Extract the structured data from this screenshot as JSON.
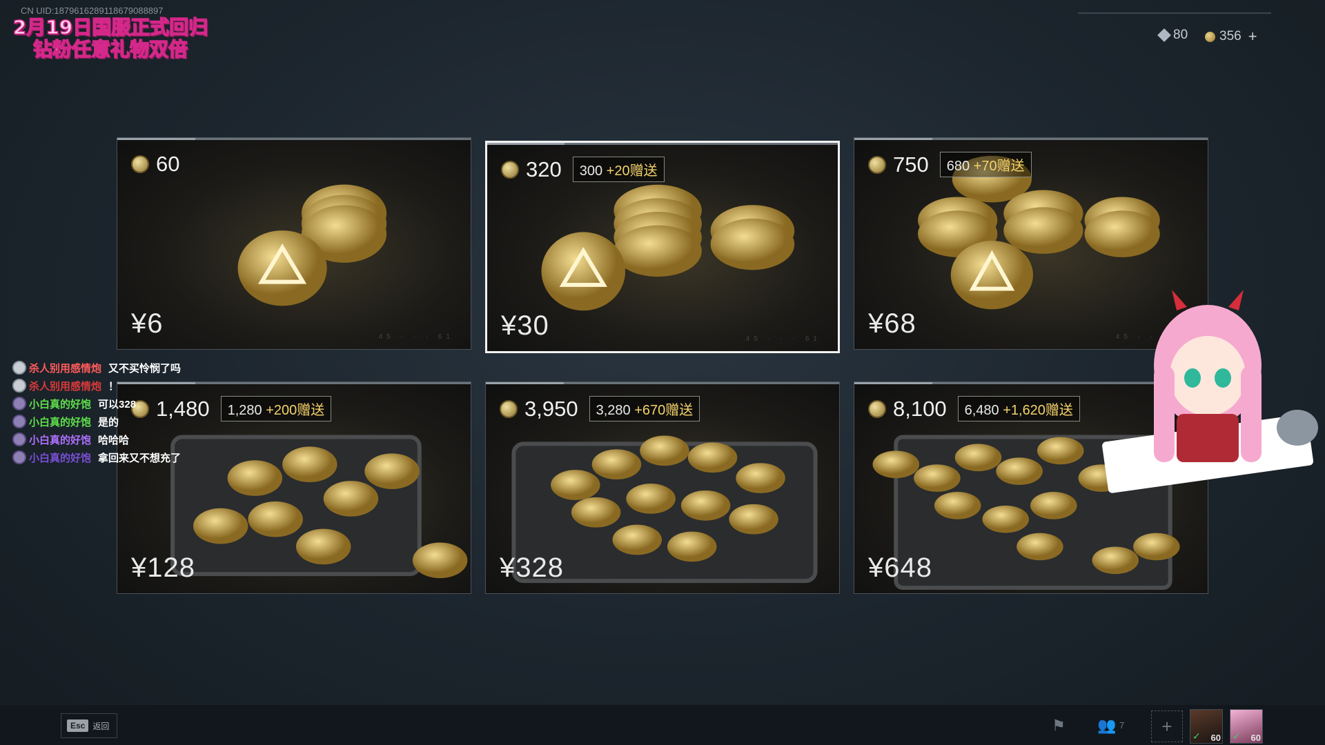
{
  "overlay": {
    "uid": "CN UID:1879616289118679088897",
    "promo_line1": "2月19日国服正式回归",
    "promo_line2": "钻粉任意礼物双倍"
  },
  "currency": {
    "diamond_icon": "diamond-icon",
    "diamond_value": "80",
    "coin_icon": "coin-icon",
    "coin_value": "356",
    "add_label": "+"
  },
  "packages": [
    {
      "coins": "60",
      "bonus_base": "",
      "bonus_gift": "",
      "price": "¥6"
    },
    {
      "coins": "320",
      "bonus_base": "300",
      "bonus_gift": "+20赠送",
      "price": "¥30"
    },
    {
      "coins": "750",
      "bonus_base": "680",
      "bonus_gift": "+70赠送",
      "price": "¥68"
    },
    {
      "coins": "1,480",
      "bonus_base": "1,280",
      "bonus_gift": "+200赠送",
      "price": "¥128"
    },
    {
      "coins": "3,950",
      "bonus_base": "3,280",
      "bonus_gift": "+670赠送",
      "price": "¥328"
    },
    {
      "coins": "8,100",
      "bonus_base": "6,480",
      "bonus_gift": "+1,620赠送",
      "price": "¥648"
    }
  ],
  "chat": [
    {
      "user": "杀人别用感情炮",
      "msg": "又不买怜悯了吗",
      "color": "#ff5b5b"
    },
    {
      "user": "杀人别用感情炮",
      "msg": "！",
      "color": "#d93a3a"
    },
    {
      "user": "小白真的好饱",
      "msg": "可以328",
      "color": "#5ee04a"
    },
    {
      "user": "小白真的好饱",
      "msg": "是的",
      "color": "#5ee04a"
    },
    {
      "user": "小白真的好饱",
      "msg": "哈哈哈",
      "color": "#b070ff"
    },
    {
      "user": "小白真的好饱",
      "msg": "拿回来又不想充了",
      "color": "#7a4fd6"
    }
  ],
  "bottombar": {
    "esc_key": "Esc",
    "esc_label": "返回",
    "squad_count": "7",
    "player1_level": "60",
    "player2_level": "60"
  },
  "colors": {
    "accent_gold": "#f5d26b",
    "selected_border": "#f2f2f2",
    "background": "#1c252d"
  }
}
